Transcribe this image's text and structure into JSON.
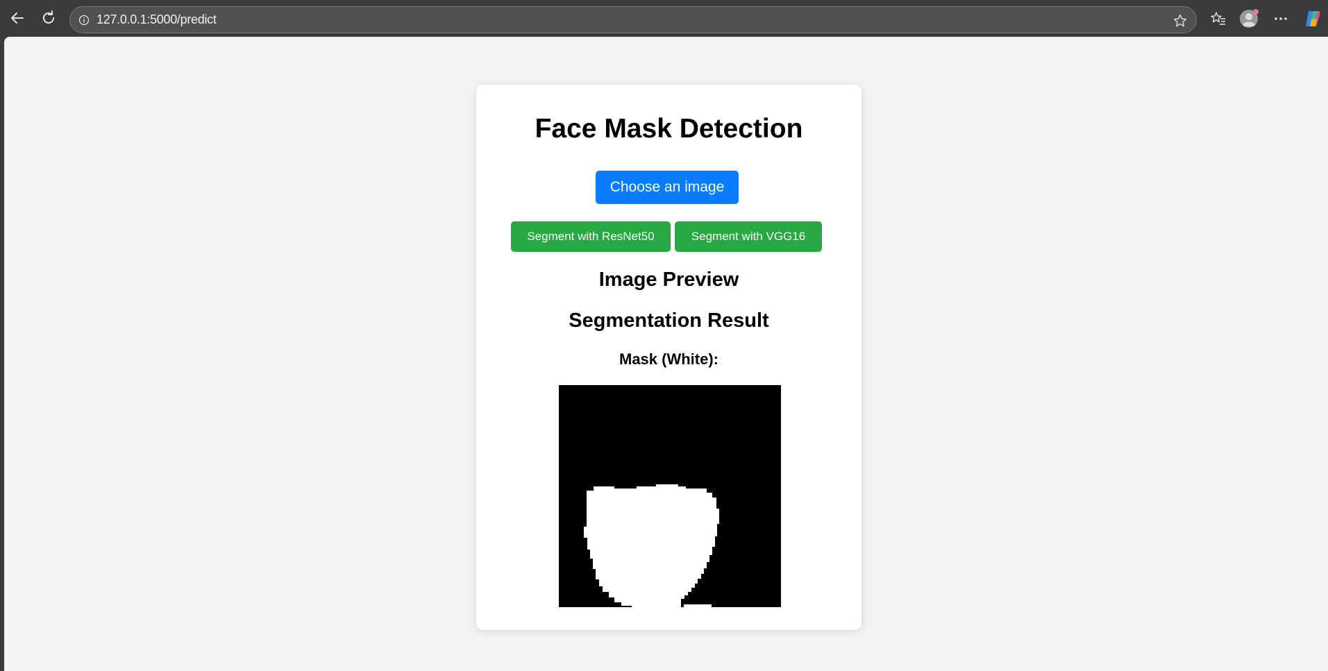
{
  "browser": {
    "url": "127.0.0.1:5000/predict",
    "icons": [
      "back-arrow-icon",
      "refresh-icon",
      "site-info-icon",
      "favorite-star-icon",
      "favorites-icon",
      "profile-avatar-icon",
      "more-menu-icon",
      "copilot-icon"
    ]
  },
  "page": {
    "title": "Face Mask Detection",
    "choose_button": "Choose an image",
    "resnet_button": "Segment with ResNet50",
    "vgg_button": "Segment with VGG16",
    "preview_heading": "Image Preview",
    "result_heading": "Segmentation Result",
    "mask_label": "Mask (White):"
  },
  "colors": {
    "primary_button": "#0a7cff",
    "segment_button": "#28a745",
    "page_background": "#f3f3f3",
    "browser_chrome": "#3b3b3b"
  }
}
